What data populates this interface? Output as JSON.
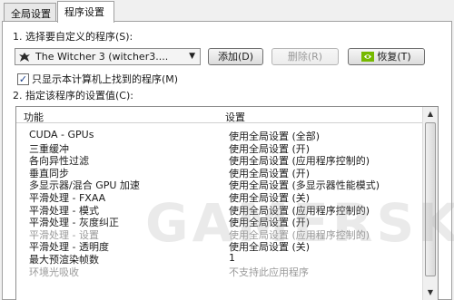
{
  "tabs": [
    {
      "label": "全局设置"
    },
    {
      "label": "程序设置"
    }
  ],
  "section1": {
    "label": "1. 选择要自定义的程序(S):"
  },
  "program_select": {
    "value": "The Witcher 3 (witcher3...."
  },
  "buttons": {
    "add": "添加(D)",
    "remove": "删除(R)",
    "restore": "恢复(T)"
  },
  "checkbox": {
    "label": "只显示本计算机上找到的程序(M)",
    "checked": true
  },
  "section2": {
    "label": "2. 指定该程序的设置值(C):"
  },
  "list": {
    "headers": {
      "feature": "功能",
      "setting": "设置"
    },
    "rows": [
      {
        "feature": "CUDA - GPUs",
        "setting": "使用全局设置 (全部)",
        "disabled": false
      },
      {
        "feature": "三重缓冲",
        "setting": "使用全局设置 (开)",
        "disabled": false
      },
      {
        "feature": "各向异性过滤",
        "setting": "使用全局设置 (应用程序控制的)",
        "disabled": false
      },
      {
        "feature": "垂直同步",
        "setting": "使用全局设置 (开)",
        "disabled": false
      },
      {
        "feature": "多显示器/混合 GPU 加速",
        "setting": "使用全局设置 (多显示器性能模式)",
        "disabled": false
      },
      {
        "feature": "平滑处理 - FXAA",
        "setting": "使用全局设置 (关)",
        "disabled": false
      },
      {
        "feature": "平滑处理 - 模式",
        "setting": "使用全局设置 (应用程序控制的)",
        "disabled": false
      },
      {
        "feature": "平滑处理 - 灰度纠正",
        "setting": "使用全局设置 (开)",
        "disabled": false
      },
      {
        "feature": "平滑处理 - 设置",
        "setting": "使用全局设置 (应用程序控制的)",
        "disabled": true
      },
      {
        "feature": "平滑处理 - 透明度",
        "setting": "使用全局设置 (关)",
        "disabled": false
      },
      {
        "feature": "最大预渲染帧数",
        "setting": "1",
        "disabled": false
      },
      {
        "feature": "环境光吸收",
        "setting": "不支持此应用程序",
        "disabled": true
      }
    ]
  },
  "watermark": "GAMERSKY"
}
